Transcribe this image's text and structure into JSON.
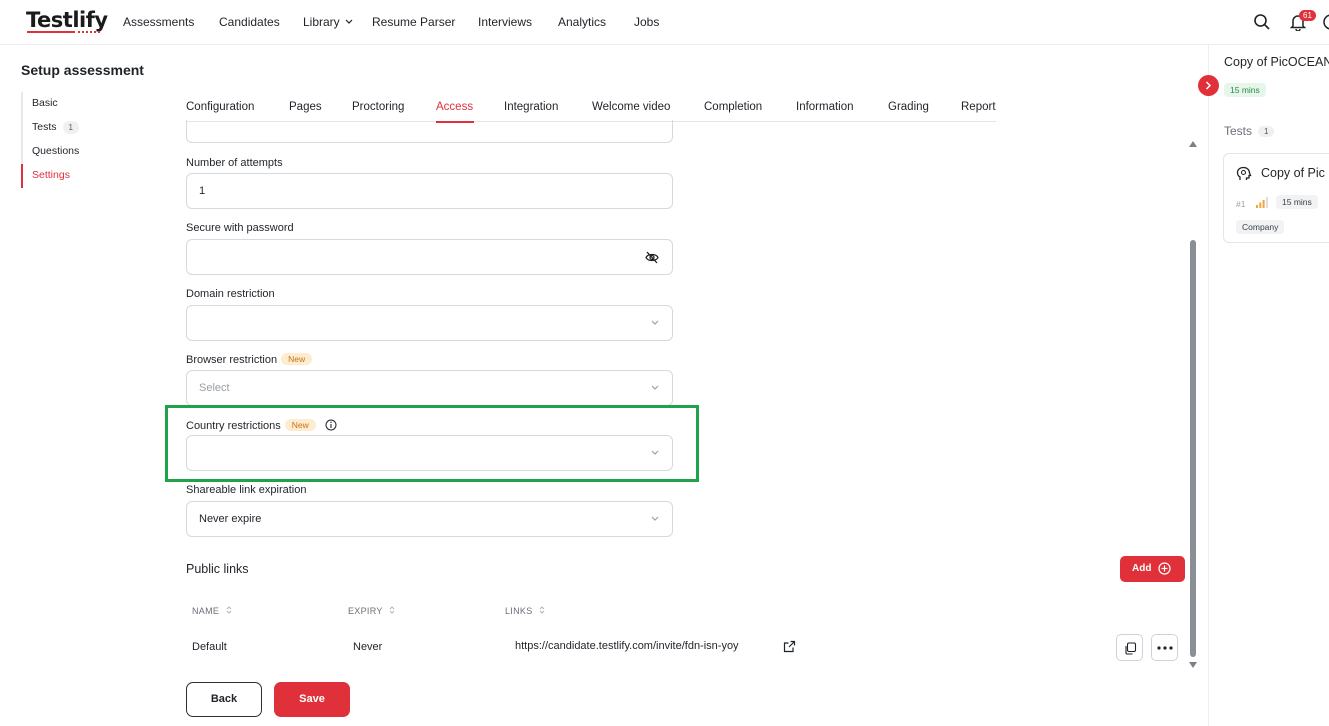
{
  "brand": {
    "logo_text": "Testlify",
    "accent": "#e0303a",
    "highlight": "#1fa34a"
  },
  "nav": {
    "items": [
      {
        "label": "Assessments"
      },
      {
        "label": "Candidates"
      },
      {
        "label": "Library"
      },
      {
        "label": "Resume Parser"
      },
      {
        "label": "Interviews"
      },
      {
        "label": "Analytics"
      },
      {
        "label": "Jobs"
      }
    ],
    "notification_count": "61",
    "icons": [
      "search-icon",
      "bell-icon",
      "chevron-down-icon"
    ]
  },
  "page": {
    "title": "Setup assessment"
  },
  "stepper": {
    "steps": [
      {
        "label": "Basic"
      },
      {
        "label": "Tests",
        "count": "1"
      },
      {
        "label": "Questions"
      },
      {
        "label": "Settings",
        "active": true
      }
    ]
  },
  "tabs": [
    {
      "label": "Configuration"
    },
    {
      "label": "Pages"
    },
    {
      "label": "Proctoring"
    },
    {
      "label": "Access",
      "active": true
    },
    {
      "label": "Integration"
    },
    {
      "label": "Welcome video"
    },
    {
      "label": "Completion"
    },
    {
      "label": "Information"
    },
    {
      "label": "Grading"
    },
    {
      "label": "Report"
    }
  ],
  "form": {
    "attempts": {
      "label": "Number of attempts",
      "value": "1"
    },
    "password": {
      "label": "Secure with password",
      "value": ""
    },
    "domain": {
      "label": "Domain restriction",
      "value": ""
    },
    "browser": {
      "label": "Browser restriction",
      "badge": "New",
      "placeholder": "Select"
    },
    "country": {
      "label": "Country restrictions",
      "badge": "New",
      "value": ""
    },
    "expiration": {
      "label": "Shareable link expiration",
      "value": "Never expire"
    }
  },
  "public_links": {
    "title": "Public links",
    "add_label": "Add",
    "columns": [
      "NAME",
      "EXPIRY",
      "LINKS"
    ],
    "rows": [
      {
        "name": "Default",
        "expiry": "Never",
        "link": "https://candidate.testlify.com/invite/fdn-isn-yoy"
      }
    ]
  },
  "actions": {
    "back_label": "Back",
    "save_label": "Save"
  },
  "right_panel": {
    "title": "Copy of PicOCEAN",
    "duration": "15 mins",
    "tests_label": "Tests",
    "tests_count": "1",
    "card": {
      "title": "Copy of Pic",
      "number": "#1",
      "duration": "15 mins",
      "tag": "Company"
    }
  }
}
